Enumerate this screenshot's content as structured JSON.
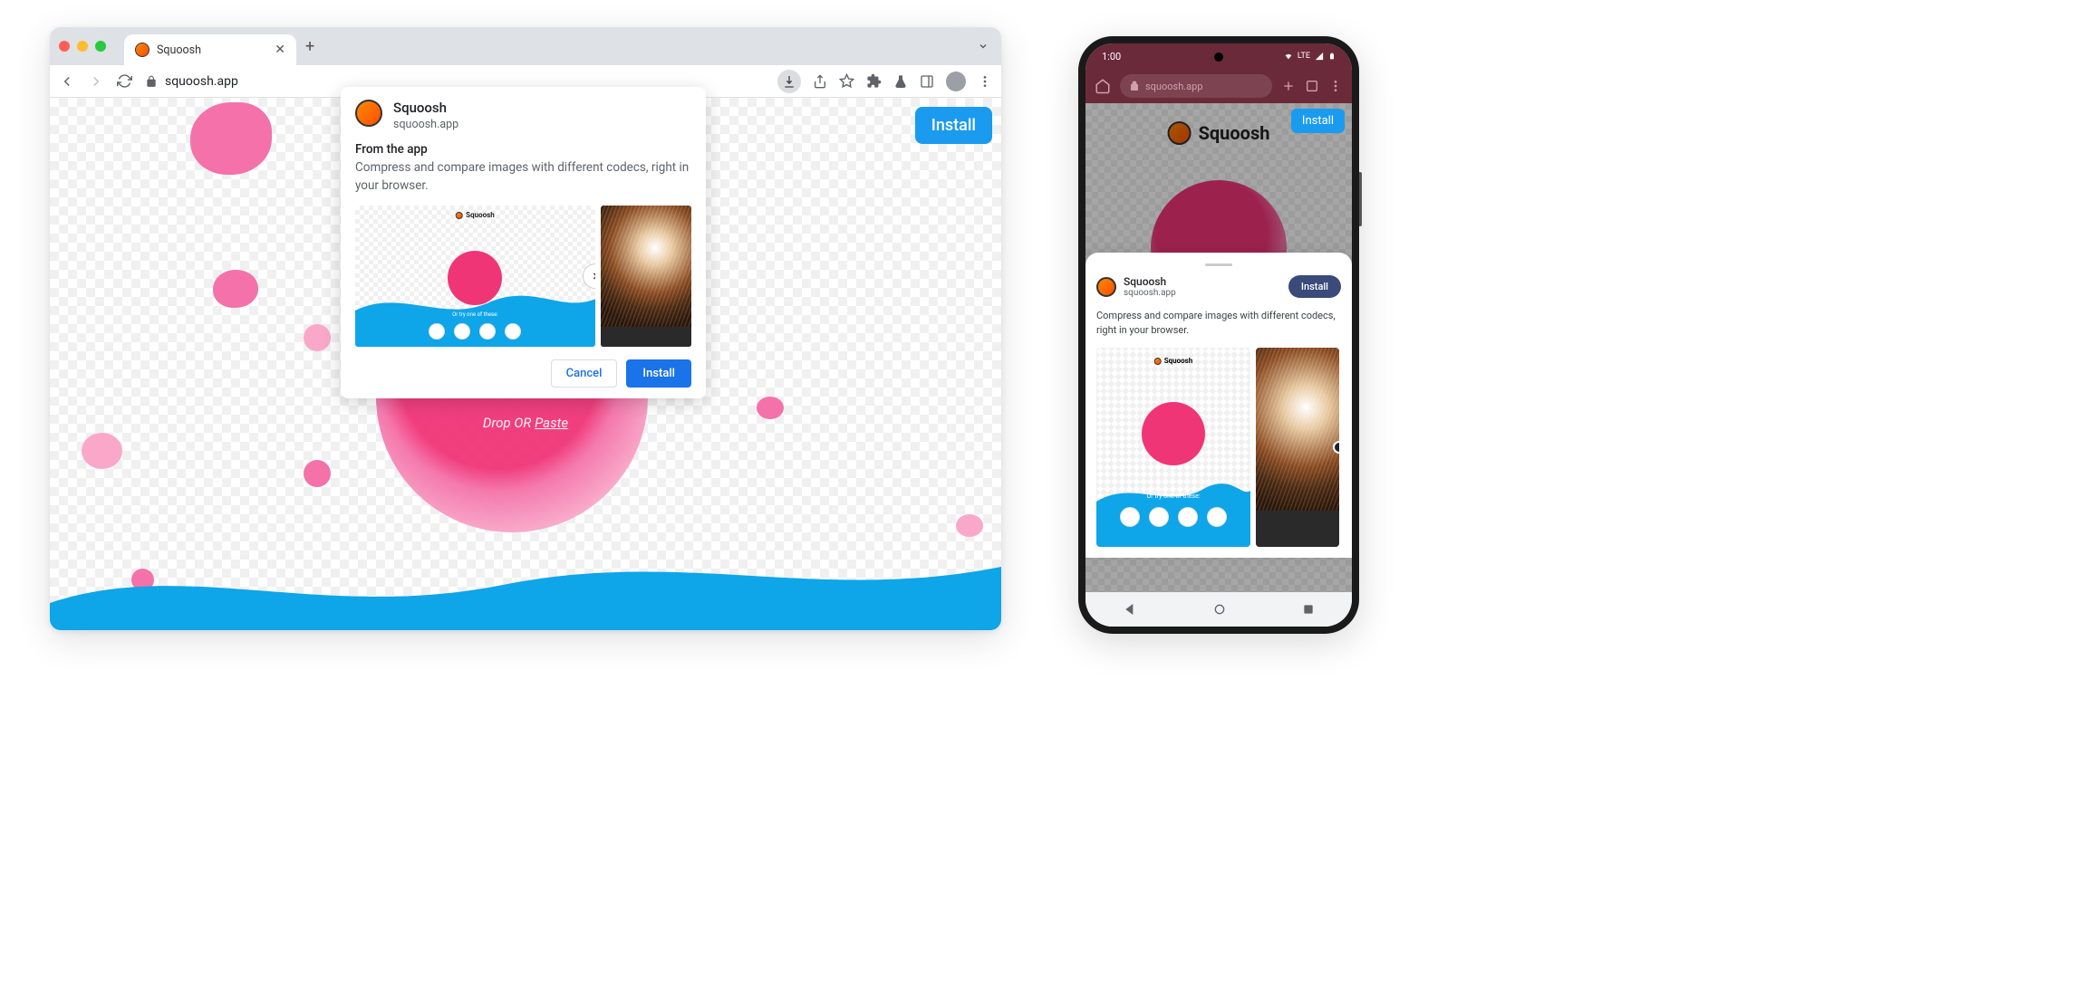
{
  "desktop": {
    "tab": {
      "title": "Squoosh"
    },
    "url": "squoosh.app",
    "page": {
      "install_button": "Install",
      "drop_text_1": "Drop ",
      "drop_text_2": "OR ",
      "drop_text_3": "Paste"
    },
    "dialog": {
      "title": "Squoosh",
      "subtitle": "squoosh.app",
      "from_label": "From the app",
      "description": "Compress and compare images with different codecs, right in your browser.",
      "screenshot1": {
        "logo": "Squoosh",
        "try_text": "Or try one of these:"
      },
      "cancel": "Cancel",
      "install": "Install"
    }
  },
  "mobile": {
    "status": {
      "time": "1:00",
      "network": "LTE"
    },
    "url": "squoosh.app",
    "page": {
      "logo_text": "Squoosh",
      "install_button": "Install"
    },
    "sheet": {
      "title": "Squoosh",
      "subtitle": "squoosh.app",
      "install": "Install",
      "description": "Compress and compare images with different codecs, right in your browser.",
      "screenshot1": {
        "logo": "Squoosh",
        "try_text": "Or try one of these:"
      }
    }
  }
}
